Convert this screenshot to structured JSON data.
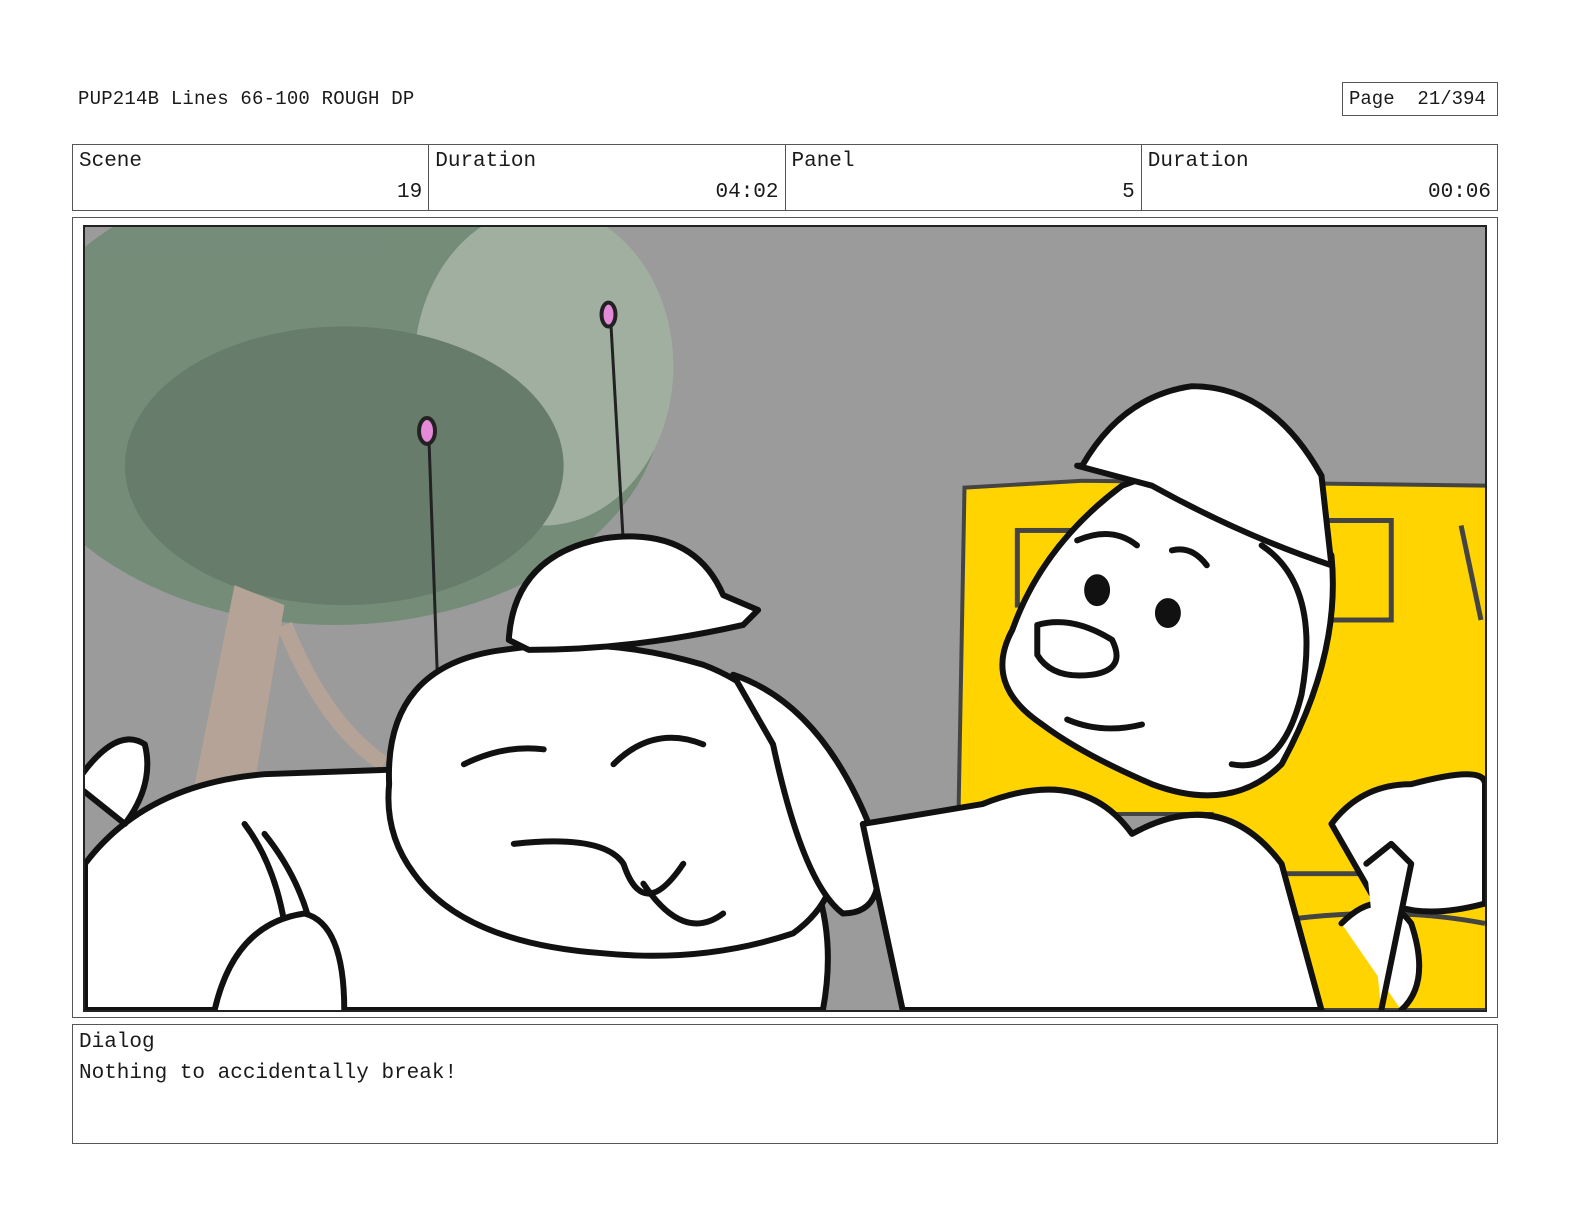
{
  "header": {
    "title": "PUP214B Lines 66-100 ROUGH DP",
    "page_label": "Page",
    "page_number": "21/394"
  },
  "info": {
    "scene_label": "Scene",
    "scene_value": "19",
    "duration_label": "Duration",
    "duration_value": "04:02",
    "panel_label": "Panel",
    "panel_value": "5",
    "panel_duration_label": "Duration",
    "panel_duration_value": "00:06"
  },
  "dialog": {
    "label": "Dialog",
    "text": "Nothing to accidentally break!"
  },
  "colors": {
    "background_gray": "#9a9a9a",
    "truck_yellow": "#ffd400",
    "antenna_tip_pink": "#e58ad8",
    "tree_green": "#6f8a74"
  }
}
